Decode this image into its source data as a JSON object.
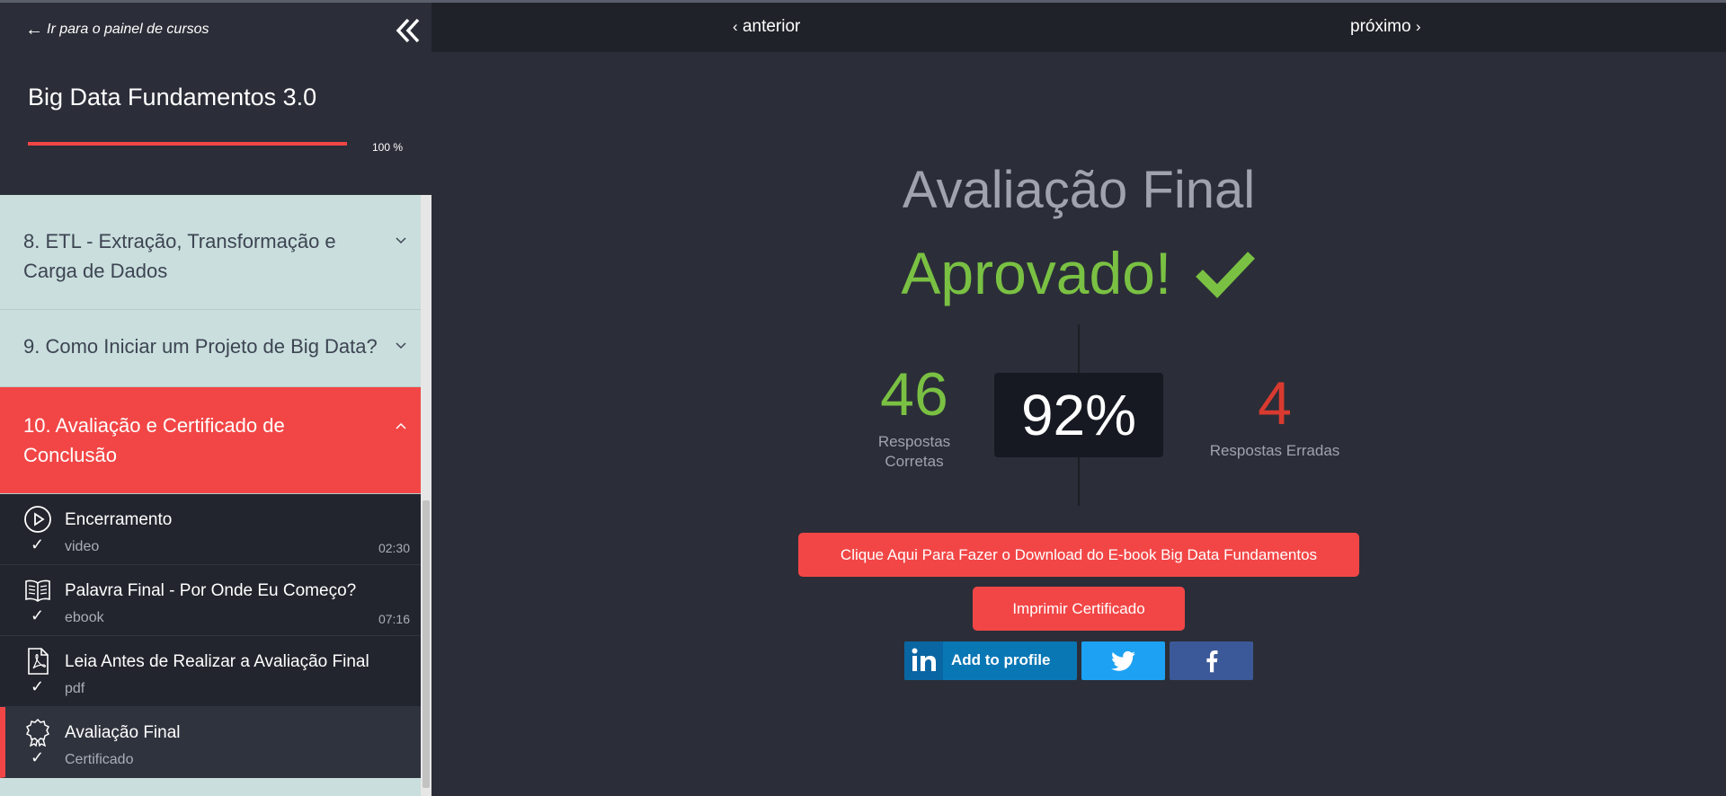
{
  "sidebar": {
    "back_link": "Ir para o painel de cursos",
    "course_title": "Big Data Fundamentos 3.0",
    "progress_label": "100 %",
    "progress_fraction": 1.0,
    "sections": [
      {
        "label": "8. ETL - Extração, Transformação e Carga de Dados",
        "active": false
      },
      {
        "label": "9. Como Iniciar um Projeto de Big Data?",
        "active": false
      },
      {
        "label": "10. Avaliação e Certificado de Conclusão",
        "active": true
      }
    ],
    "lessons": [
      {
        "title": "Encerramento",
        "type": "video",
        "duration": "02:30",
        "icon": "play-icon",
        "completed": true
      },
      {
        "title": "Palavra Final - Por Onde Eu Começo?",
        "type": "ebook",
        "duration": "07:16",
        "icon": "book-icon",
        "completed": true
      },
      {
        "title": "Leia Antes de Realizar a Avaliação Final",
        "type": "pdf",
        "duration": "",
        "icon": "pdf-icon",
        "completed": true
      },
      {
        "title": "Avaliação Final",
        "type": "Certificado",
        "duration": "",
        "icon": "award-icon",
        "completed": true,
        "current": true
      }
    ],
    "check_mark": "✓"
  },
  "nav": {
    "prev_label": "anterior",
    "next_label": "próximo"
  },
  "main": {
    "heading": "Avaliação Final",
    "result": "Aprovado!",
    "correct_count": "46",
    "correct_label_line1": "Respostas",
    "correct_label_line2": "Corretas",
    "score": "92%",
    "wrong_count": "4",
    "wrong_label": "Respostas Erradas",
    "ebook_button": "Clique Aqui Para Fazer o Download do E-book Big Data Fundamentos",
    "certificate_button": "Imprimir Certificado",
    "linkedin_button": "Add to profile"
  },
  "colors": {
    "accent": "#f24646",
    "success": "#7ac143",
    "error": "#d93a30",
    "sidebar_bg": "#c9dedd",
    "dark_bg": "#2b2e38",
    "linkedin": "#0a77b5",
    "twitter": "#1da1f2",
    "facebook": "#3b5998"
  }
}
